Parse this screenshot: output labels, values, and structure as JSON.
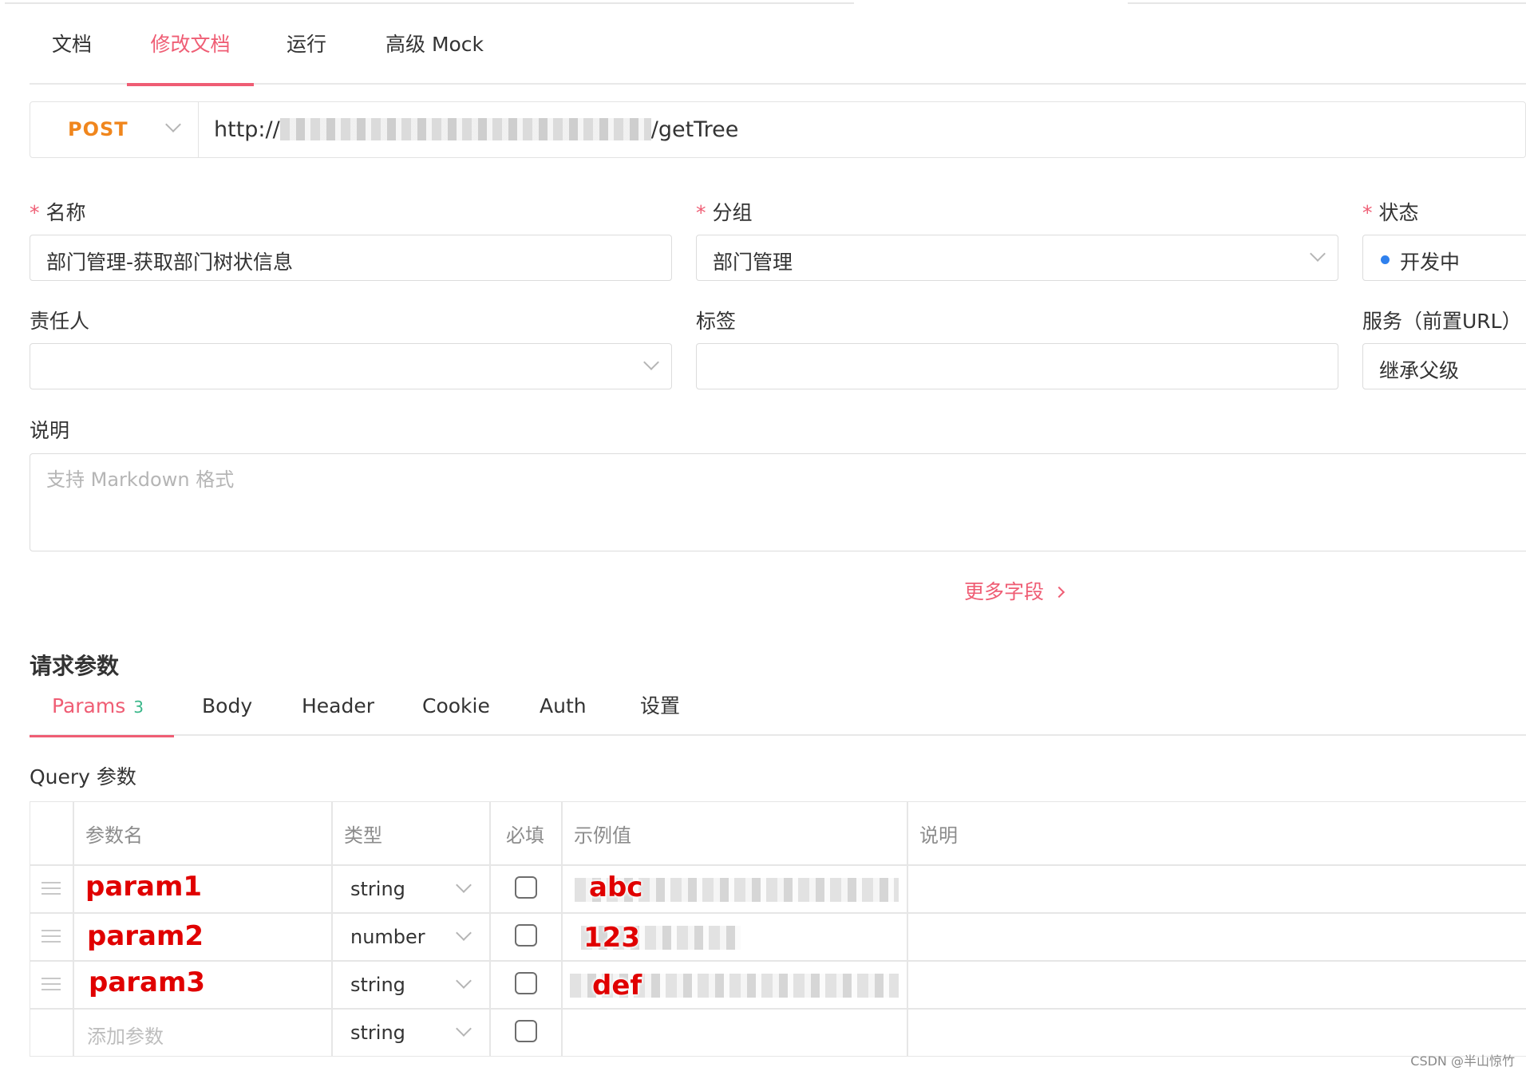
{
  "top_tabs": [
    {
      "label": "文档"
    },
    {
      "label": "修改文档",
      "active": true
    },
    {
      "label": "运行"
    },
    {
      "label": "高级 Mock"
    }
  ],
  "request": {
    "method": "POST",
    "url_prefix": "http://",
    "url_suffix": "/getTree"
  },
  "form": {
    "name_label": "名称",
    "name_value": "部门管理-获取部门树状信息",
    "group_label": "分组",
    "group_value": "部门管理",
    "status_label": "状态",
    "status_value": "开发中",
    "owner_label": "责任人",
    "owner_value": "",
    "tags_label": "标签",
    "tags_value": "",
    "service_label": "服务（前置URL）",
    "service_value": "继承父级",
    "desc_label": "说明",
    "desc_placeholder": "支持 Markdown 格式",
    "required_mark": "*"
  },
  "more_fields_label": "更多字段",
  "request_params_title": "请求参数",
  "param_tabs": [
    {
      "label": "Params",
      "count": "3",
      "active": true
    },
    {
      "label": "Body"
    },
    {
      "label": "Header"
    },
    {
      "label": "Cookie"
    },
    {
      "label": "Auth"
    },
    {
      "label": "设置"
    }
  ],
  "query_title": "Query 参数",
  "table": {
    "headers": [
      "参数名",
      "类型",
      "必填",
      "示例值",
      "说明"
    ],
    "rows": [
      {
        "name": "param1",
        "type": "string",
        "required": false,
        "example": "abc"
      },
      {
        "name": "param2",
        "type": "number",
        "required": false,
        "example": "123"
      },
      {
        "name": "param3",
        "type": "string",
        "required": false,
        "example": "def"
      }
    ],
    "add_row": {
      "name_placeholder": "添加参数",
      "type": "string",
      "required": false
    }
  },
  "watermark": "CSDN @半山惊竹",
  "colors": {
    "accent": "#ef5d74",
    "method_post": "#f0861d",
    "status_dot": "#2f80ed",
    "count_badge": "#3ab78a",
    "annotation_red": "#e00000"
  }
}
